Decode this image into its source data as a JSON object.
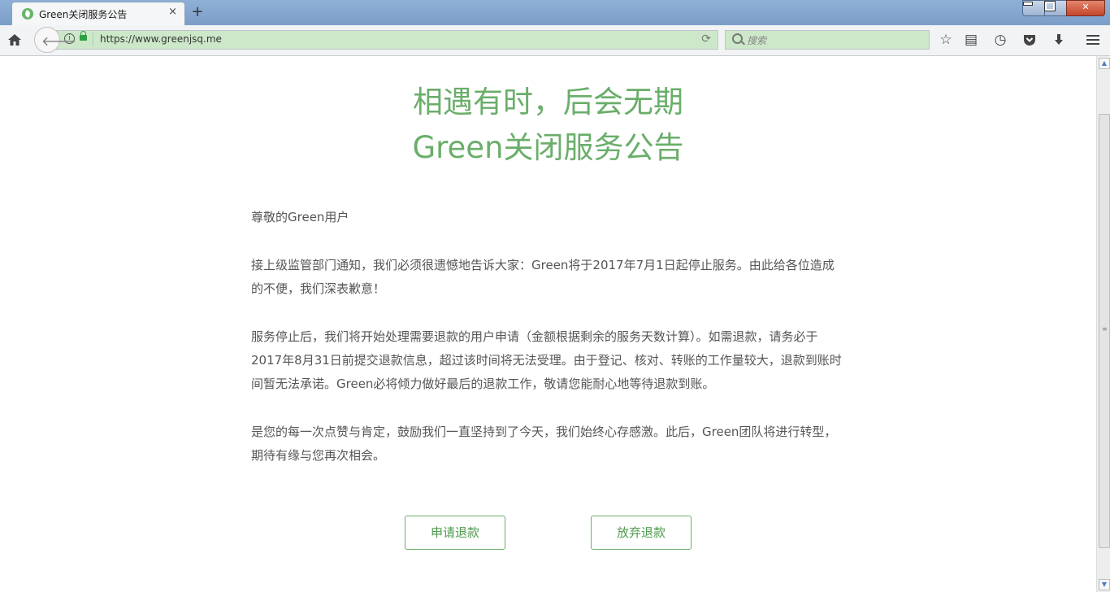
{
  "browser": {
    "tab_title": "Green关闭服务公告",
    "tab_close": "×",
    "new_tab": "+",
    "url": "https://www.greenjsq.me",
    "search_placeholder": "搜索",
    "icons": {
      "home": "home-icon",
      "back": "back-arrow-icon",
      "info": "info-icon",
      "lock": "lock-icon",
      "reload": "reload-icon",
      "bookmark": "star-icon",
      "reading_list": "library-icon",
      "history": "history-icon",
      "pocket": "pocket-icon",
      "downloads": "download-icon",
      "menu": "hamburger-menu-icon"
    },
    "url_color": "#cce8c9"
  },
  "page": {
    "headline1": "相遇有时，后会无期",
    "headline2": "Green关闭服务公告",
    "greeting": "尊敬的Green用户",
    "paragraphs": [
      "接上级监管部门通知，我们必须很遗憾地告诉大家：Green将于2017年7月1日起停止服务。由此给各位造成的不便，我们深表歉意！",
      "服务停止后，我们将开始处理需要退款的用户申请（金额根据剩余的服务天数计算）。如需退款，请务必于2017年8月31日前提交退款信息，超过该时间将无法受理。由于登记、核对、转账的工作量较大，退款到账时间暂无法承诺。Green必将倾力做好最后的退款工作，敬请您能耐心地等待退款到账。",
      "是您的每一次点赞与肯定，鼓励我们一直坚持到了今天，我们始终心存感激。此后，Green团队将进行转型，期待有缘与您再次相会。"
    ],
    "buttons": {
      "apply_refund": "申请退款",
      "waive_refund": "放弃退款"
    },
    "accent_color": "#6aae6a"
  }
}
